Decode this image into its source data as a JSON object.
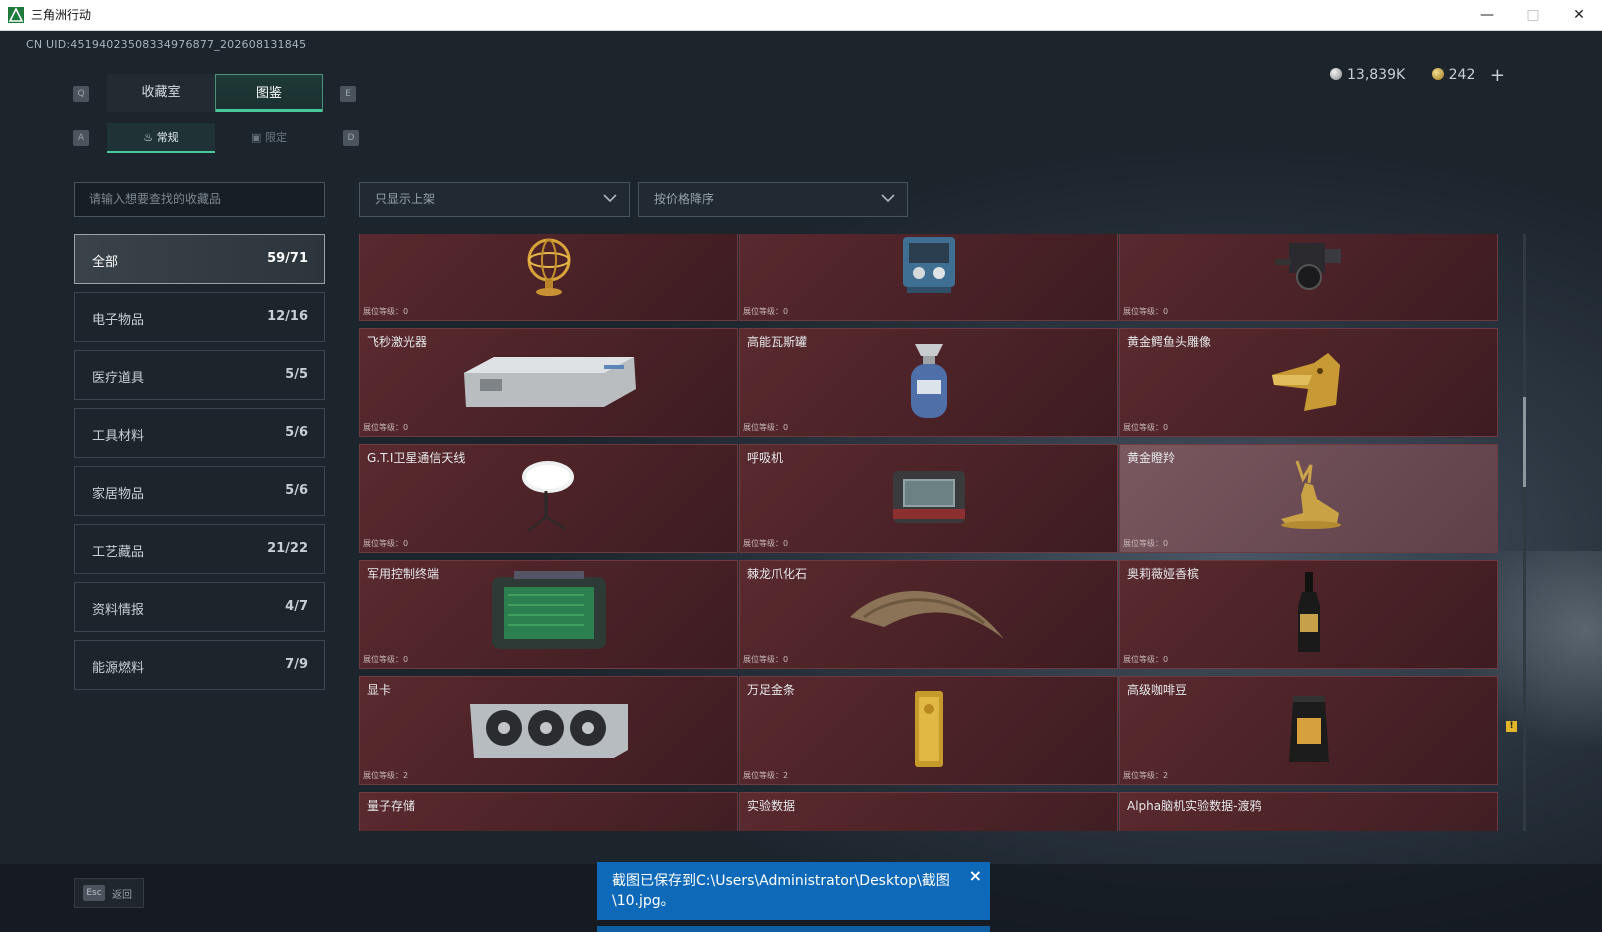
{
  "window": {
    "title": "三角洲行动",
    "minimize_icon": "minimize-icon",
    "maximize_icon": "maximize-icon",
    "close_icon": "close-icon"
  },
  "header": {
    "uid": "CN UID:4519402350833497687​7_202608131845"
  },
  "currency": {
    "silver": "13,839K",
    "gold": "242",
    "add": "+"
  },
  "tabs": [
    {
      "label": "收藏室",
      "key": "Q"
    },
    {
      "label": "图鉴",
      "key": "E"
    }
  ],
  "subtabs": [
    {
      "label": "常规",
      "key": "A"
    },
    {
      "label": "限定",
      "key": "D"
    }
  ],
  "search": {
    "placeholder": "请输入想要查找的收藏品"
  },
  "filters": {
    "show": "只显示上架",
    "sort": "按价格降序"
  },
  "categories": [
    {
      "label": "全部",
      "count": "59/71"
    },
    {
      "label": "电子物品",
      "count": "12/16"
    },
    {
      "label": "医疗道具",
      "count": "5/5"
    },
    {
      "label": "工具材料",
      "count": "5/6"
    },
    {
      "label": "家居物品",
      "count": "5/6"
    },
    {
      "label": "工艺藏品",
      "count": "21/22"
    },
    {
      "label": "资料情报",
      "count": "4/7"
    },
    {
      "label": "能源燃料",
      "count": "7/9"
    }
  ],
  "level_label": "展位等级：",
  "items": [
    {
      "name": "",
      "level": "0",
      "icon": "armillary-sphere"
    },
    {
      "name": "",
      "level": "0",
      "icon": "machine"
    },
    {
      "name": "",
      "level": "0",
      "icon": "camera"
    },
    {
      "name": "飞秒激光器",
      "level": "0",
      "icon": "laser-device"
    },
    {
      "name": "高能瓦斯罐",
      "level": "0",
      "icon": "gas-canister"
    },
    {
      "name": "黄金鳄鱼头雕像",
      "level": "0",
      "icon": "gold-crocodile-head"
    },
    {
      "name": "G.T.I卫星通信天线",
      "level": "0",
      "icon": "satellite-dish"
    },
    {
      "name": "呼吸机",
      "level": "0",
      "icon": "ventilator"
    },
    {
      "name": "黄金瞪羚",
      "level": "0",
      "icon": "gold-gazelle"
    },
    {
      "name": "军用控制终端",
      "level": "0",
      "icon": "control-terminal"
    },
    {
      "name": "棘龙爪化石",
      "level": "0",
      "icon": "claw-fossil"
    },
    {
      "name": "奥莉薇娅香槟",
      "level": "0",
      "icon": "champagne-bottle"
    },
    {
      "name": "显卡",
      "level": "2",
      "icon": "graphics-card"
    },
    {
      "name": "万足金条",
      "level": "2",
      "icon": "gold-bar"
    },
    {
      "name": "高级咖啡豆",
      "level": "2",
      "icon": "coffee-bag"
    },
    {
      "name": "量子存储",
      "level": "",
      "icon": "quantum-storage"
    },
    {
      "name": "实验数据",
      "level": "",
      "icon": "experiment-data"
    },
    {
      "name": "Alpha脑机实验数据-渡鸦",
      "level": "",
      "icon": "alpha-data"
    }
  ],
  "badge": "!",
  "bottom": {
    "esc_key": "Esc",
    "esc_label": "返回"
  },
  "toast": {
    "message": "截图已保存到C:\\Users\\Administrator\\Desktop\\截图\\10.jpg。",
    "close": "×"
  },
  "colors": {
    "accent": "#49c89a",
    "card_bg": "#4a2227",
    "toast_bg": "#0e6ab8"
  }
}
